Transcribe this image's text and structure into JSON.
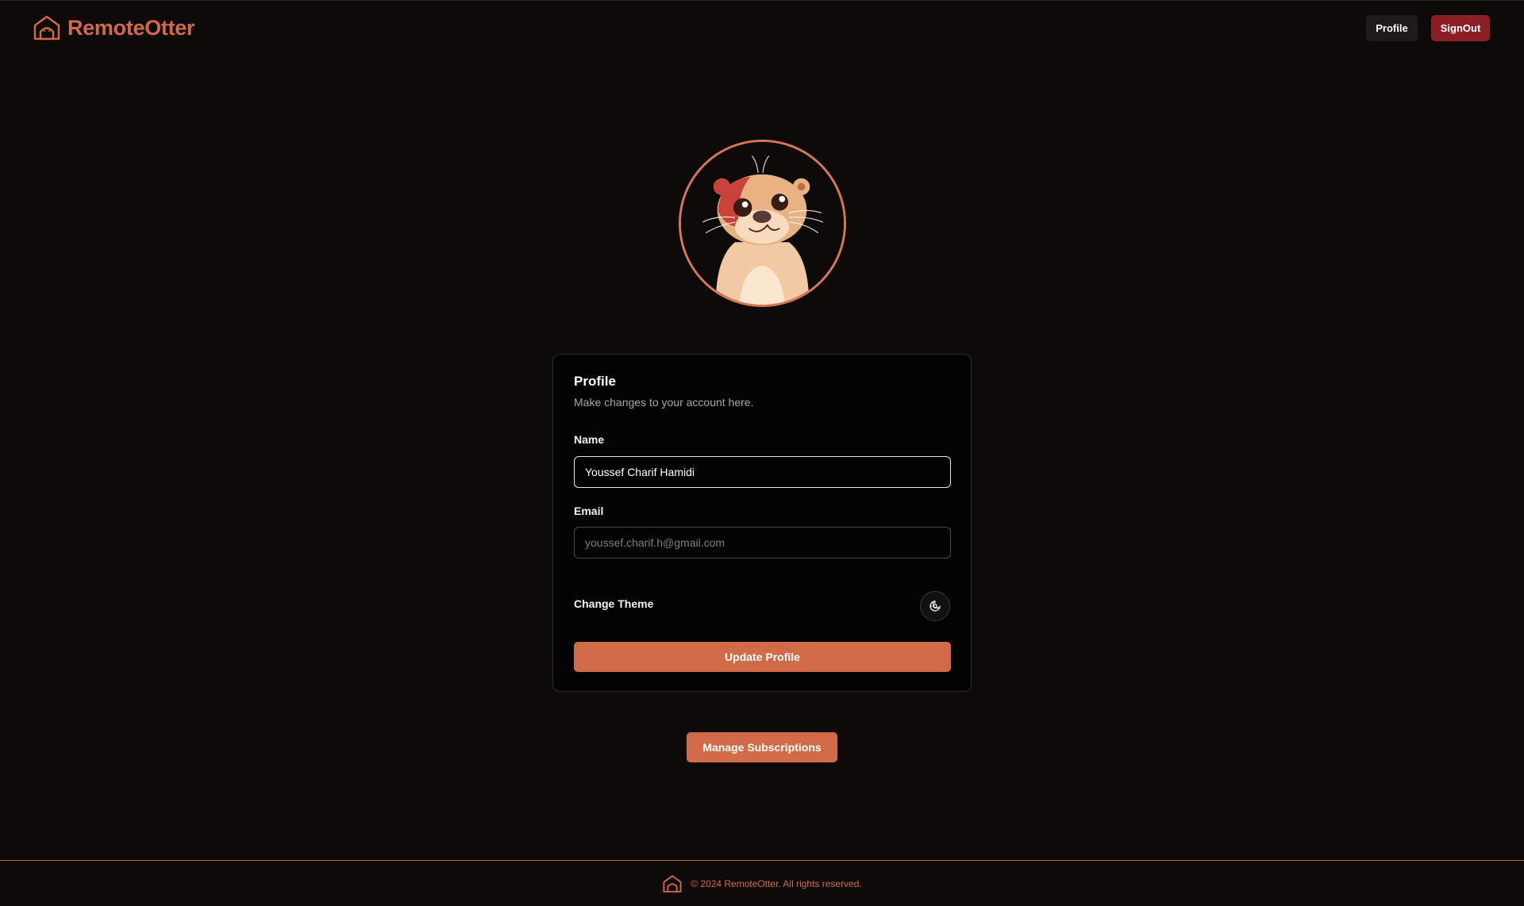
{
  "header": {
    "brand_name": "RemoteOtter",
    "nav": {
      "profile_label": "Profile",
      "signout_label": "SignOut"
    }
  },
  "card": {
    "title": "Profile",
    "subtitle": "Make changes to your account here.",
    "name_label": "Name",
    "name_value": "Youssef Charif Hamidi",
    "email_label": "Email",
    "email_placeholder": "youssef.charif.h@gmail.com",
    "theme_label": "Change Theme",
    "update_label": "Update Profile"
  },
  "manage_label": "Manage Subscriptions",
  "footer": {
    "copyright": "© 2024 RemoteOtter. All rights reserved."
  },
  "icons": {
    "logo": "house-otter-icon",
    "theme": "moon-sun-icon"
  },
  "colors": {
    "accent": "#d16a46",
    "signout": "#8c1e26",
    "background": "#0d0b0a"
  }
}
